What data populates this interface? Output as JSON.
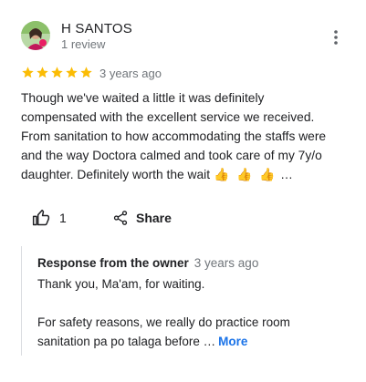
{
  "review": {
    "author": {
      "name": "H SANTOS",
      "review_count": "1 review"
    },
    "rating": {
      "stars": 5,
      "max_stars": 5,
      "color": "#fbbc04"
    },
    "time_ago": "3 years ago",
    "text_lines": [
      "Though we've waited a little it was definitely",
      "compensated with the excellent service we received.",
      "From sanitation to how accommodating the staffs were",
      "and the way Doctora calmed and took care of my 7y/o",
      "daughter. Definitely worth the wait"
    ],
    "emoji": "👍 👍 👍",
    "ellipsis": "…",
    "icons": {
      "menu": "more-vert-icon",
      "like": "thumb-up-icon",
      "share": "share-icon"
    },
    "actions": {
      "like_count": "1",
      "share_label": "Share"
    },
    "owner_response": {
      "heading": "Response from the owner",
      "time_ago": "3 years ago",
      "line_1": "Thank you, Ma'am, for waiting.",
      "line_2": "For safety reasons, we really do practice room",
      "line_3": "sanitation pa po talaga before …",
      "more_label": "More",
      "link_color": "#1a73e8"
    }
  }
}
